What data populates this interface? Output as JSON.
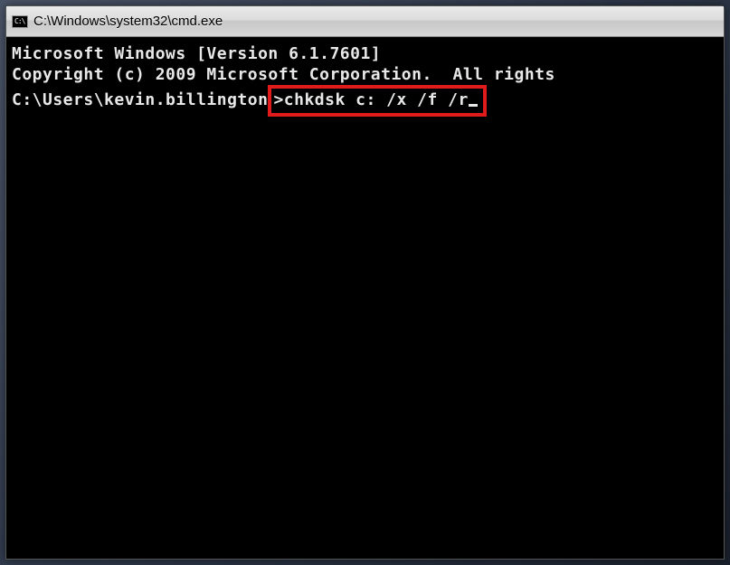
{
  "titlebar": {
    "icon_label": "C:\\",
    "title": "C:\\Windows\\system32\\cmd.exe"
  },
  "terminal": {
    "line1": "Microsoft Windows [Version 6.1.7601]",
    "line2": "Copyright (c) 2009 Microsoft Corporation.  All rights",
    "blank": "",
    "prompt": "C:\\Users\\kevin.billington",
    "command": ">chkdsk c: /x /f /r"
  }
}
